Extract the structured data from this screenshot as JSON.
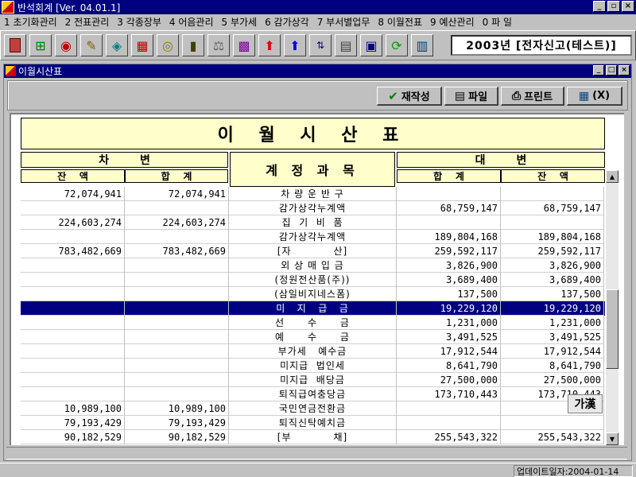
{
  "window": {
    "title": "반석회계 [Ver. 04.01.1]",
    "minimize": "_",
    "restore": "▫",
    "close": "×"
  },
  "menu": [
    "1 초기화관리",
    "2 전표관리",
    "3 각종장부",
    "4 어음관리",
    "5 부가세",
    "6 감가상각",
    "7 부서별업무",
    "8 이월전표",
    "9 예산관리",
    "0 파 일"
  ],
  "toolbar": {
    "icons": [
      "exit-icon",
      "tree-icon",
      "globe-icon",
      "pencil-icon",
      "tag-icon",
      "abacus-icon",
      "coin-icon",
      "book-icon",
      "balance-icon",
      "grid-icon",
      "arrow-up-red-icon",
      "arrow-up-blue-icon",
      "sort-icon",
      "calculator-icon",
      "print-preview-icon",
      "refresh-icon",
      "report-icon"
    ],
    "company": "2003년 [전자신고(테스트)]"
  },
  "child_window": {
    "title": "이월시산표",
    "minimize": "_",
    "restore": "□",
    "close": "×"
  },
  "actions": {
    "rebuild": "재작성",
    "file": "파일",
    "print": "프린트",
    "exit": "(X)",
    "rebuild_icon": "✔",
    "file_icon": "▤",
    "print_icon": "⎙",
    "exit_icon": "▦"
  },
  "report": {
    "title": "이 월 시 산 표",
    "debit_header": "차        변",
    "credit_header": "대        변",
    "account_header": "계 정 과 목",
    "debit_balance": "잔    액",
    "debit_total": "합    계",
    "credit_total": "합    계",
    "credit_balance": "잔    액",
    "rows": [
      [
        "72,074,941",
        "72,074,941",
        "차 량 운 반 구",
        "",
        ""
      ],
      [
        "",
        "",
        "감가상각누계액",
        "68,759,147",
        "68,759,147"
      ],
      [
        "224,603,274",
        "224,603,274",
        "집  기  비  품",
        "",
        ""
      ],
      [
        "",
        "",
        "감가상각누계액",
        "189,804,168",
        "189,804,168"
      ],
      [
        "783,482,669",
        "783,482,669",
        "[자           산]",
        "259,592,117",
        "259,592,117"
      ],
      [
        "",
        "",
        "외 상 매 입 금",
        "3,826,900",
        "3,826,900"
      ],
      [
        "",
        "",
        "(정원전산품(주))",
        "3,689,400",
        "3,689,400"
      ],
      [
        "",
        "",
        "(삼일비지네스폼)",
        "137,500",
        "137,500"
      ],
      [
        "",
        "",
        "미   지   급   금",
        "19,229,120",
        "19,229,120"
      ],
      [
        "",
        "",
        "선      수      금",
        "1,231,000",
        "1,231,000"
      ],
      [
        "",
        "",
        "예      수      금",
        "3,491,525",
        "3,491,525"
      ],
      [
        "",
        "",
        "부가세   예수금",
        "17,912,544",
        "17,912,544"
      ],
      [
        "",
        "",
        "미지급  법인세",
        "8,641,790",
        "8,641,790"
      ],
      [
        "",
        "",
        "미지급  배당금",
        "27,500,000",
        "27,500,000"
      ],
      [
        "",
        "",
        "퇴직급여충당금",
        "173,710,443",
        "173,710,443"
      ],
      [
        "10,989,100",
        "10,989,100",
        "국민연금전환금",
        "",
        ""
      ],
      [
        "79,193,429",
        "79,193,429",
        "퇴직신탁예치금",
        "",
        ""
      ],
      [
        "90,182,529",
        "90,182,529",
        "[부           채]",
        "255,543,322",
        "255,543,322"
      ]
    ],
    "selected_row": 8
  },
  "ime": "가漢",
  "scroll_up": "▲",
  "scroll_down": "▼",
  "status": "업데이트일자:2004-01-14",
  "colors": {
    "title_bar": "#000080",
    "header_fill": "#ffffcc",
    "selection": "#000080"
  }
}
